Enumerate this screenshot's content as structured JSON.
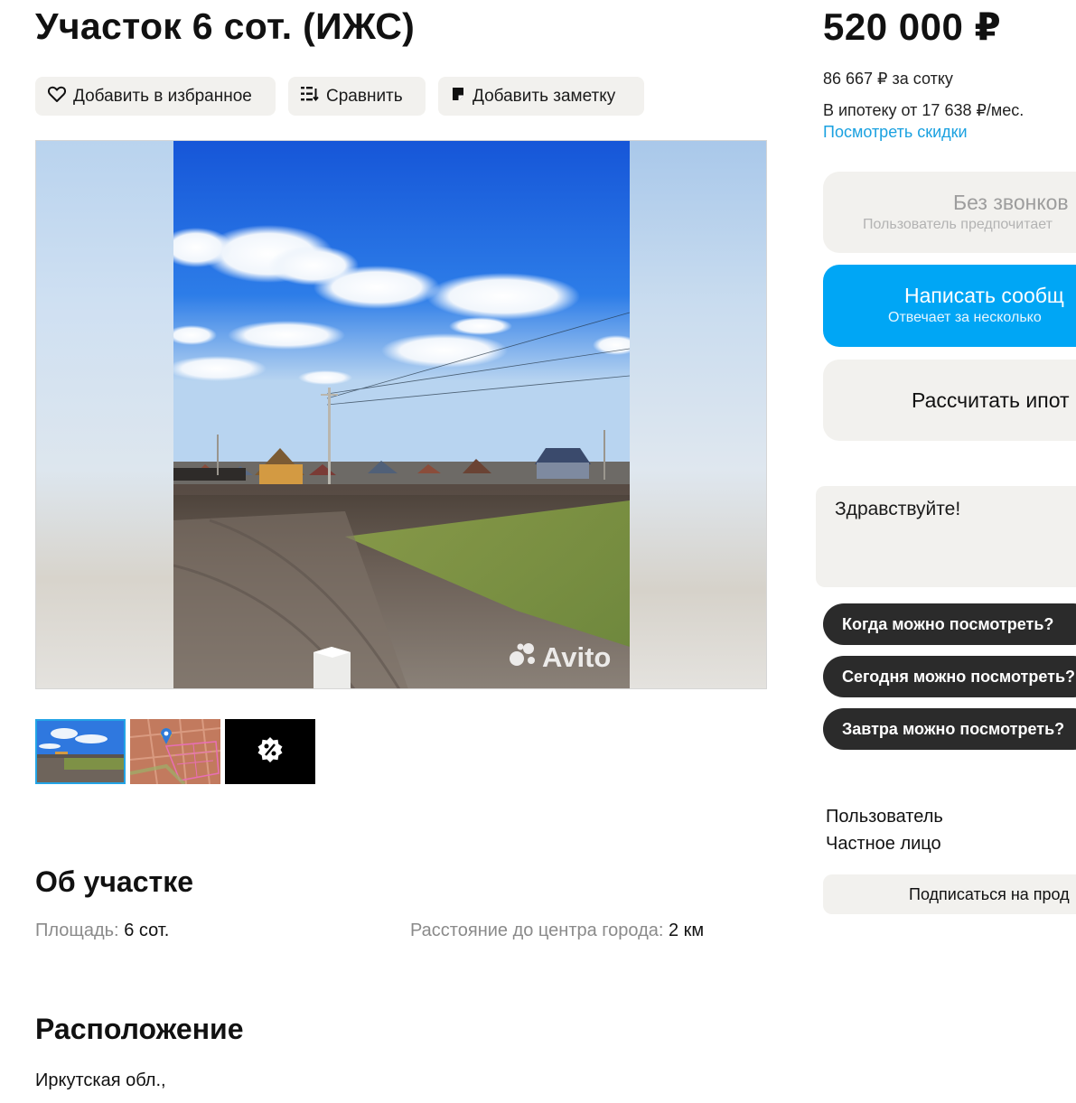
{
  "listing": {
    "title": "Участок 6 сот. (ИЖС)"
  },
  "actions": {
    "favorite_label": "Добавить в избранное",
    "compare_label": "Сравнить",
    "note_label": "Добавить заметку"
  },
  "photo": {
    "watermark": "Avito",
    "thumbnails_count": 3
  },
  "pricing": {
    "price": "520 000 ₽",
    "per_unit": "86 667 ₽ за сотку",
    "mortgage": "В ипотеку от 17 638 ₽/мес.",
    "discounts_link": "Посмотреть скидки"
  },
  "contact": {
    "no_calls_title": "Без звонков",
    "no_calls_sub": "Пользователь предпочитает",
    "message_title": "Написать сообщ",
    "message_sub": "Отвечает за несколько",
    "mortgage_button": "Рассчитать ипот",
    "message_placeholder": "Здравствуйте!",
    "quick_replies": [
      "Когда можно посмотреть?",
      "Сегодня можно посмотреть?",
      "Завтра можно посмотреть?"
    ]
  },
  "seller": {
    "name": "Пользователь",
    "type": "Частное лицо",
    "subscribe_label": "Подписаться на прод"
  },
  "about": {
    "heading": "Об участке",
    "area_label": "Площадь:",
    "area_value": "6 сот.",
    "distance_label": "Расстояние до центра города:",
    "distance_value": "2 км"
  },
  "location": {
    "heading": "Расположение",
    "address": "Иркутская обл.,"
  },
  "colors": {
    "accent_blue": "#00a6f5",
    "link_blue": "#1aa1e0",
    "chip_dark": "#2b2b2b",
    "button_gray": "#f2f1ee"
  }
}
